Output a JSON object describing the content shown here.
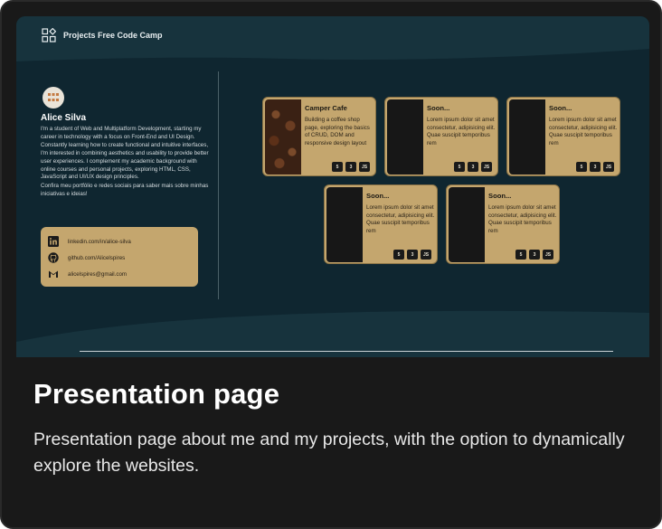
{
  "site": {
    "logo_text": "Projects Free Code Camp",
    "colors": {
      "background": "#0f2630",
      "accent": "#c4a66e",
      "dark": "#171717"
    }
  },
  "profile": {
    "name": "Alice Silva",
    "bio": "I'm a student of Web and Multiplatform Development, starting my career in technology with a focus on Front-End and UI Design. Constantly learning how to create functional and intuitive interfaces, I'm interested in combining aesthetics and usability to provide better user experiences. I complement my academic background with online courses and personal projects, exploring HTML, CSS, JavaScript and UI/UX design principles.",
    "bio_cta": "Confira meu portfólio e redes sociais para saber mais sobre minhas iniciativas e ideias!"
  },
  "contacts": [
    {
      "icon": "linkedin-icon",
      "text": "linkedin.com/in/alice-silva"
    },
    {
      "icon": "github-icon",
      "text": "github.com/Alicelspires"
    },
    {
      "icon": "gmail-icon",
      "text": "alicelspires@gmail.com"
    }
  ],
  "projects": [
    {
      "title": "Camper Cafe",
      "description": "Building a coffee shop page, exploring the basics of CRUD, DOM and responsive design layout",
      "badges": [
        "5",
        "3",
        "JS"
      ]
    },
    {
      "title": "Soon...",
      "description": "Lorem ipsum dolor sit amet consectetur, adipisicing elit. Quae suscipit temporibus rem",
      "badges": [
        "5",
        "3",
        "JS"
      ]
    },
    {
      "title": "Soon...",
      "description": "Lorem ipsum dolor sit amet consectetur, adipisicing elit. Quae suscipit temporibus rem",
      "badges": [
        "5",
        "3",
        "JS"
      ]
    },
    {
      "title": "Soon...",
      "description": "Lorem ipsum dolor sit amet consectetur, adipisicing elit. Quae suscipit temporibus rem",
      "badges": [
        "5",
        "3",
        "JS"
      ]
    },
    {
      "title": "Soon...",
      "description": "Lorem ipsum dolor sit amet consectetur, adipisicing elit. Quae suscipit temporibus rem",
      "badges": [
        "5",
        "3",
        "JS"
      ]
    }
  ],
  "card": {
    "title": "Presentation page",
    "description": "Presentation page about me and my projects, with the option to dynamically explore the websites."
  }
}
